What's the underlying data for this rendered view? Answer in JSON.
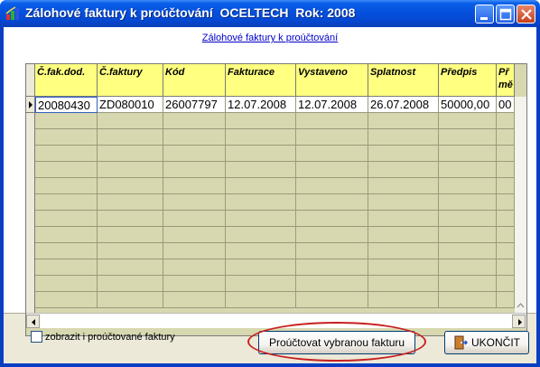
{
  "window": {
    "title_prefix": "Zálohové faktury k proúčtování",
    "title_company": "OCELTECH",
    "title_year": "Rok: 2008",
    "buttons": [
      "minimize",
      "maximize",
      "close"
    ]
  },
  "panel": {
    "link_title": "Zálohové faktury k proúčtování"
  },
  "grid": {
    "columns": [
      "Č.fak.dod.",
      "Č.faktury",
      "Kód",
      "Fakturace",
      "Vystaveno",
      "Splatnost",
      "Předpis",
      "Př\nmě"
    ],
    "rows": [
      [
        "20080430",
        "ZD080010",
        "26007797",
        "12.07.2008",
        "12.07.2008",
        "26.07.2008",
        "50000,00",
        "00"
      ]
    ]
  },
  "footer": {
    "checkbox_label": "zobrazit i proúčtované faktury",
    "checkbox_checked": false,
    "process_button": "Proúčtovat vybranou fakturu",
    "end_button": "UKONČIT"
  },
  "colors": {
    "header_bg": "#ffff80",
    "grid_bg": "#d8d8b0",
    "highlight_oval": "#c82020",
    "title_bar": "#0552df"
  }
}
